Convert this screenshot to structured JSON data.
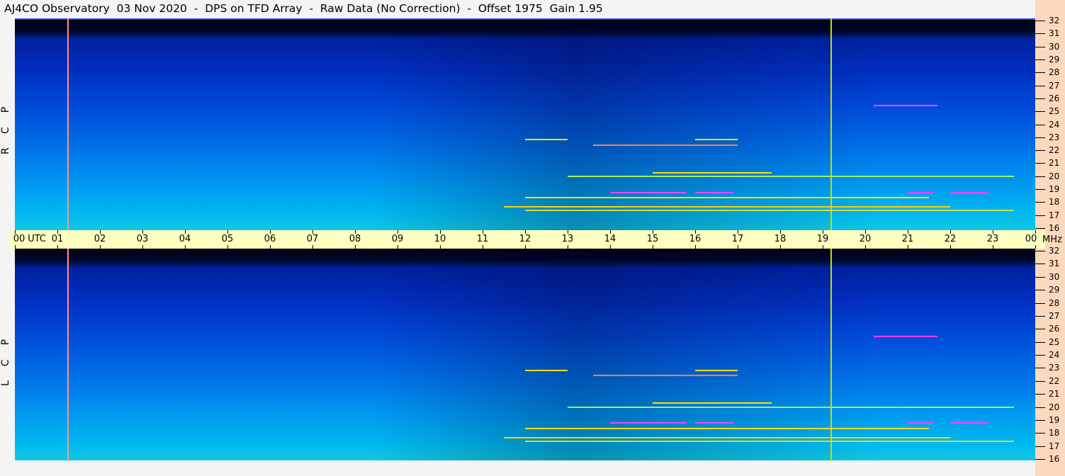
{
  "title": "AJ4CO Observatory  03 Nov 2020  -  DPS on TFD Array  -  Raw Data (No Correction)  -  Offset 1975  Gain 1.95",
  "panels": [
    {
      "label": "RCP"
    },
    {
      "label": "LCP"
    }
  ],
  "chart_data": {
    "type": "heatmap",
    "title": "AJ4CO Observatory  03 Nov 2020  -  DPS on TFD Array  -  Raw Data (No Correction)  -  Offset 1975  Gain 1.95",
    "xlabel": "UTC",
    "ylabel": "MHz",
    "x_ticks": [
      "00",
      "01",
      "02",
      "03",
      "04",
      "05",
      "06",
      "07",
      "08",
      "09",
      "10",
      "11",
      "12",
      "13",
      "14",
      "15",
      "16",
      "17",
      "18",
      "19",
      "20",
      "21",
      "22",
      "23",
      "00"
    ],
    "y_ticks": [
      16,
      17,
      18,
      19,
      20,
      21,
      22,
      23,
      24,
      25,
      26,
      27,
      28,
      29,
      30,
      31,
      32
    ],
    "xlim": [
      0,
      24
    ],
    "ylim": [
      16,
      32
    ],
    "utc_label": "UTC",
    "mhz_label": "MHz",
    "markers_utc": [
      1.23,
      19.18
    ],
    "marker_colors": [
      "#ff9090",
      "#c0e000"
    ]
  }
}
